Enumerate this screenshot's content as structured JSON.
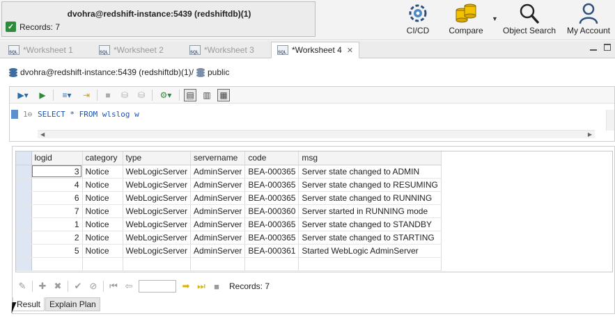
{
  "connection": {
    "title": "dvohra@redshift-instance:5439 (redshiftdb)(1)",
    "records_label": "Records: 7"
  },
  "toolbar": {
    "cicd_label": "CI/CD",
    "compare_label": "Compare",
    "object_search_label": "Object Search",
    "my_account_label": "My Account"
  },
  "tabs": [
    {
      "label": "*Worksheet 1",
      "active": false
    },
    {
      "label": "*Worksheet 2",
      "active": false
    },
    {
      "label": "*Worksheet 3",
      "active": false
    },
    {
      "label": "*Worksheet 4",
      "active": true
    }
  ],
  "path": {
    "connection": "dvohra@redshift-instance:5439 (redshiftdb)(1)/",
    "schema": "public"
  },
  "editor": {
    "line_number": "1",
    "code": "SELECT * FROM wlslog w"
  },
  "results": {
    "columns": [
      "logid",
      "category",
      "type",
      "servername",
      "code",
      "msg"
    ],
    "rows": [
      [
        "3",
        "Notice",
        "WebLogicServer",
        "AdminServer",
        "BEA-000365",
        "Server state changed to ADMIN"
      ],
      [
        "4",
        "Notice",
        "WebLogicServer",
        "AdminServer",
        "BEA-000365",
        "Server state changed to RESUMING"
      ],
      [
        "6",
        "Notice",
        "WebLogicServer",
        "AdminServer",
        "BEA-000365",
        "Server state changed to RUNNING"
      ],
      [
        "7",
        "Notice",
        "WebLogicServer",
        "AdminServer",
        "BEA-000360",
        "Server started in RUNNING mode"
      ],
      [
        "1",
        "Notice",
        "WebLogicServer",
        "AdminServer",
        "BEA-000365",
        "Server state changed to STANDBY"
      ],
      [
        "2",
        "Notice",
        "WebLogicServer",
        "AdminServer",
        "BEA-000365",
        "Server state changed to STARTING"
      ],
      [
        "5",
        "Notice",
        "WebLogicServer",
        "AdminServer",
        "BEA-000361",
        "Started WebLogic AdminServer"
      ]
    ],
    "records_label": "Records: 7",
    "page_value": ""
  },
  "bottom_tabs": [
    {
      "label": "Result",
      "active": true
    },
    {
      "label": "Explain Plan",
      "active": false
    }
  ],
  "colors": {
    "accent_blue": "#3f6da0",
    "success_green": "#2e8b3a",
    "nav_yellow": "#d8b400",
    "row_header_blue": "#dde6f2"
  }
}
